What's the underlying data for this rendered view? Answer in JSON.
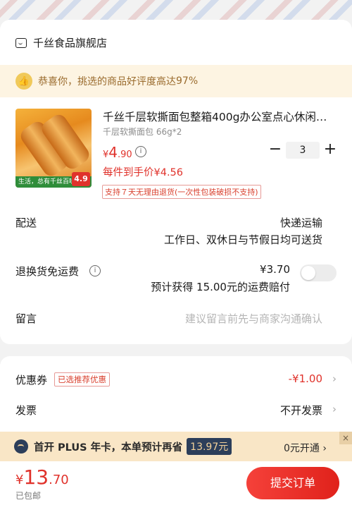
{
  "store": {
    "name": "千丝食品旗舰店"
  },
  "praise": {
    "text_prefix": "恭喜你，挑选的商品好评度高达 ",
    "rate": "97%"
  },
  "product": {
    "title": "千丝千层软撕面包整箱400g办公室点心休闲…",
    "spec": "千层软撕面包 66g*2",
    "price_symbol": "¥",
    "price_int": "4",
    "price_dec": ".90",
    "info_icon": "i",
    "quantity": "3",
    "each_price": "每件到手价¥4.56",
    "return_policy": "支持７天无理由退货(一次性包装破损不支持)",
    "image_strip": "生活，总有千丝百味",
    "image_badge": "4.9"
  },
  "delivery": {
    "label": "配送",
    "method": "快递运输",
    "schedule": "工作日、双休日与节假日均可送货"
  },
  "return_insurance": {
    "label": "退换货免运费",
    "price": "¥3.70",
    "note_prefix": "预计获得 ",
    "amount": "15.00",
    "note_suffix": "元的运费赔付",
    "enabled": false
  },
  "message": {
    "label": "留言",
    "placeholder": "建议留言前先与商家沟通确认"
  },
  "coupon": {
    "label": "优惠券",
    "tag": "已选推荐优惠",
    "value": "-¥1.00",
    "chevron": "›"
  },
  "invoice": {
    "label": "发票",
    "value": "不开发票",
    "chevron": "›"
  },
  "plus": {
    "text": "首开 PLUS 年卡，本单预计再省",
    "amount": "13.97元",
    "action": "0元开通",
    "chevron": "›",
    "close": "×"
  },
  "checkout": {
    "symbol": "¥",
    "total_int": "13",
    "total_dec": ".70",
    "shipping": "已包邮",
    "submit": "提交订单"
  },
  "colors": {
    "accent": "#e0322b",
    "praise_bg": "#fdf4e2",
    "plus_bg": "#f9e6c6"
  }
}
